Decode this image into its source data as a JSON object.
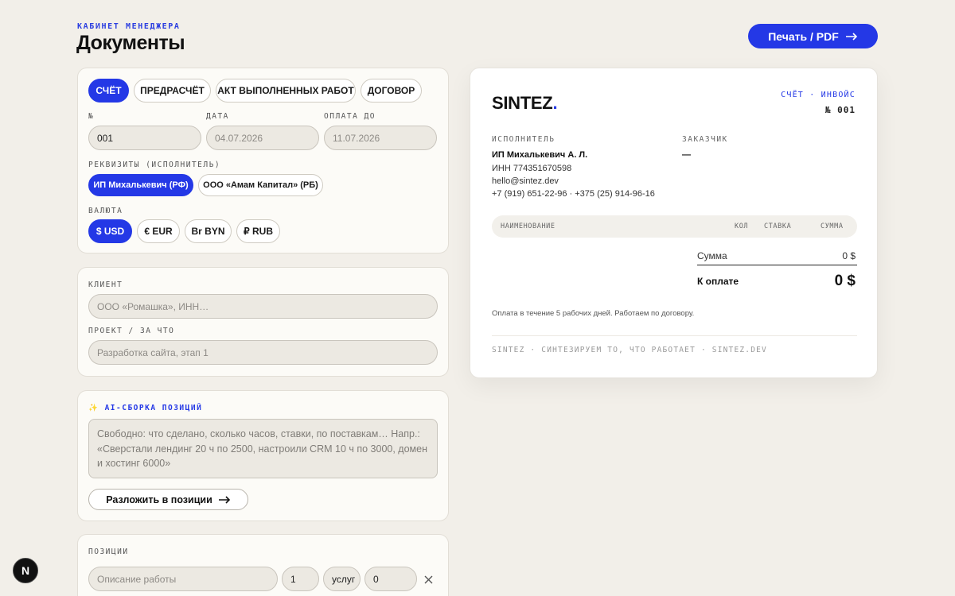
{
  "header": {
    "eyebrow": "КАБИНЕТ МЕНЕДЖЕРА",
    "title": "Документы",
    "print_label": "Печать / PDF"
  },
  "doc_types": [
    "СЧЁТ",
    "ПРЕДРАСЧЁТ",
    "АКТ ВЫПОЛНЕННЫХ РАБОТ",
    "ДОГОВОР"
  ],
  "active_doc_type": "СЧЁТ",
  "meta": {
    "number_label": "№",
    "number_value": "001",
    "date_label": "ДАТА",
    "date_value": "04.07.2026",
    "due_label": "ОПЛАТА ДО",
    "due_value": "11.07.2026"
  },
  "requisites": {
    "label": "РЕКВИЗИТЫ (ИСПОЛНИТЕЛЬ)",
    "options": [
      "ИП Михалькевич (РФ)",
      "ООО «Амам Капитал» (РБ)"
    ],
    "selected": "ИП Михалькевич (РФ)"
  },
  "currency": {
    "label": "ВАЛЮТА",
    "options": [
      "$ USD",
      "€ EUR",
      "Br BYN",
      "₽ RUB"
    ],
    "selected": "$ USD"
  },
  "client": {
    "label": "КЛИЕНТ",
    "placeholder": "ООО «Ромашка», ИНН…",
    "project_label": "ПРОЕКТ / ЗА ЧТО",
    "project_placeholder": "Разработка сайта, этап 1"
  },
  "ai": {
    "sparkle": "✨",
    "label": "AI-СБОРКА ПОЗИЦИЙ",
    "placeholder": "Свободно: что сделано, сколько часов, ставки, по поставкам… Напр.: «Сверстали лендинг 20 ч по 2500, настроили CRM 10 ч по 3000, домен и хостинг 6000»",
    "button_label": "Разложить в позиции"
  },
  "positions": {
    "label": "ПОЗИЦИИ",
    "description_placeholder": "Описание работы",
    "qty": "1",
    "unit": "услуг",
    "rate": "0"
  },
  "preview": {
    "logo_text": "SINTEZ",
    "logo_dot": ".",
    "doc_type": "СЧЁТ · ИНВОЙС",
    "doc_number": "№ 001",
    "executor_label": "ИСПОЛНИТЕЛЬ",
    "executor_lines": [
      "ИП Михалькевич А. Л.",
      "ИНН 774351670598",
      "hello@sintez.dev",
      "+7 (919) 651-22-96 · +375 (25) 914-96-16"
    ],
    "customer_label": "ЗАКАЗЧИК",
    "customer_value": "—",
    "table_headers": [
      "НАИМЕНОВАНИЕ",
      "КОЛ",
      "СТАВКА",
      "СУММА"
    ],
    "sum_label": "Сумма",
    "sum_value": "0 $",
    "total_label": "К оплате",
    "total_value": "0 $",
    "note": "Оплата в течение 5 рабочих дней. Работаем по договору.",
    "footer": "SINTEZ · СИНТЕЗИРУЕМ ТО, ЧТО РАБОТАЕТ · SINTEZ.DEV"
  },
  "dev_badge": "N",
  "colors": {
    "accent": "#2438e6",
    "background": "#f2efe9",
    "card": "#fcfbf7",
    "field": "#ece9e2"
  }
}
